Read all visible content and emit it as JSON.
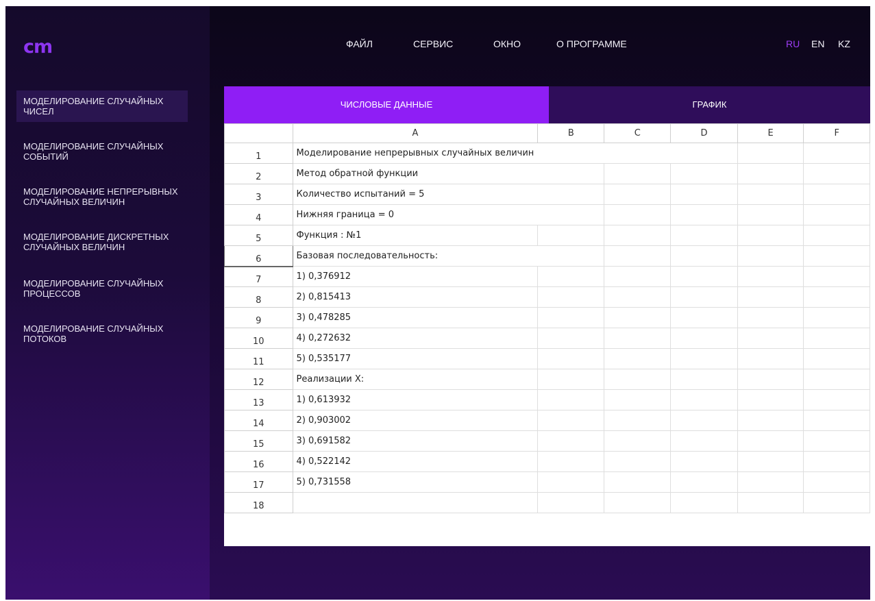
{
  "logo": "cm",
  "menu": [
    "ФАЙЛ",
    "СЕРВИС",
    "ОКНО",
    "О ПРОГРАММЕ"
  ],
  "languages": [
    "RU",
    "EN",
    "KZ"
  ],
  "active_language": "RU",
  "sidebar": {
    "items": [
      {
        "label": "МОДЕЛИРОВАНИЕ СЛУЧАЙНЫХ ЧИСЕЛ",
        "active": true
      },
      {
        "label": "МОДЕЛИРОВАНИЕ СЛУЧАЙНЫХ СОБЫТИЙ"
      },
      {
        "label": "МОДЕЛИРОВАНИЕ НЕПРЕРЫВНЫХ СЛУЧАЙНЫХ ВЕЛИЧИН"
      },
      {
        "label": "МОДЕЛИРОВАНИЕ ДИСКРЕТНЫХ СЛУЧАЙНЫХ ВЕЛИЧИН"
      },
      {
        "label": "МОДЕЛИРОВАНИЕ СЛУЧАЙНЫХ ПРОЦЕССОВ"
      },
      {
        "label": "МОДЕЛИРОВАНИЕ СЛУЧАЙНЫХ ПОТОКОВ"
      }
    ]
  },
  "tabs": [
    {
      "label": "ЧИСЛОВЫЕ ДАННЫЕ",
      "active": true
    },
    {
      "label": "ГРАФИК"
    }
  ],
  "grid": {
    "columns": [
      "A",
      "B",
      "C",
      "D",
      "E",
      "F"
    ],
    "rows": [
      {
        "n": "1",
        "a": "Моделирование непрерывных случайных величин"
      },
      {
        "n": "2",
        "a": "Метод обратной функции"
      },
      {
        "n": "3",
        "a": "Количество испытаний = 5"
      },
      {
        "n": "4",
        "a": "Нижняя граница = 0"
      },
      {
        "n": "5",
        "a": "Функция : №1"
      },
      {
        "n": "6",
        "a": "Базовая последовательность:"
      },
      {
        "n": "7",
        "a": "1) 0,376912"
      },
      {
        "n": "8",
        "a": "2) 0,815413"
      },
      {
        "n": "9",
        "a": "3) 0,478285"
      },
      {
        "n": "10",
        "a": "4) 0,272632"
      },
      {
        "n": "11",
        "a": "5) 0,535177"
      },
      {
        "n": "12",
        "a": "Реализации X:"
      },
      {
        "n": "13",
        "a": "1) 0,613932"
      },
      {
        "n": "14",
        "a": "2) 0,903002"
      },
      {
        "n": "15",
        "a": "3) 0,691582"
      },
      {
        "n": "16",
        "a": "4) 0,522142"
      },
      {
        "n": "17",
        "a": "5) 0,731558"
      },
      {
        "n": "18",
        "a": ""
      }
    ],
    "selected_row": "6"
  },
  "colors": {
    "accent": "#8f1ef5",
    "logo": "#8d35f0",
    "active_lang": "#9d3cf5",
    "tab_inactive": "#2f0d5a"
  }
}
